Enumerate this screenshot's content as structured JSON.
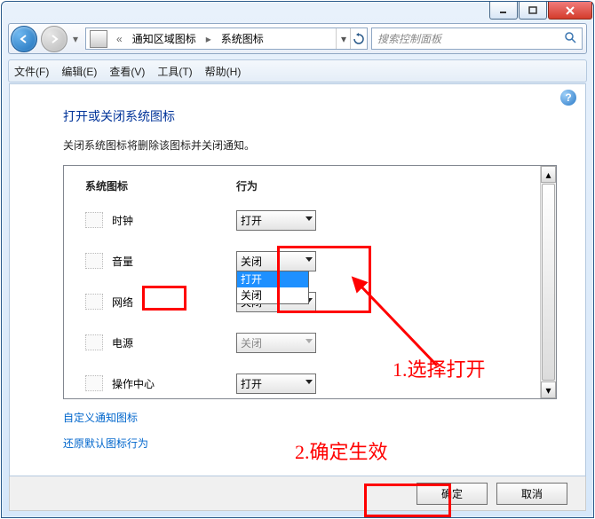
{
  "breadcrumb": {
    "item1": "通知区域图标",
    "item2": "系统图标"
  },
  "search": {
    "placeholder": "搜索控制面板"
  },
  "menu": {
    "file": "文件(F)",
    "edit": "编辑(E)",
    "view": "查看(V)",
    "tools": "工具(T)",
    "help": "帮助(H)"
  },
  "heading": "打开或关闭系统图标",
  "subtext": "关闭系统图标将删除该图标并关闭通知。",
  "columns": {
    "c1": "系统图标",
    "c2": "行为"
  },
  "options": {
    "open": "打开",
    "close": "关闭"
  },
  "rows": [
    {
      "label": "时钟",
      "value": "打开",
      "disabled": false
    },
    {
      "label": "音量",
      "value": "关闭",
      "disabled": false,
      "dropdownOpen": true
    },
    {
      "label": "网络",
      "value": "关闭",
      "disabled": false
    },
    {
      "label": "电源",
      "value": "关闭",
      "disabled": true
    },
    {
      "label": "操作中心",
      "value": "打开",
      "disabled": false
    }
  ],
  "links": {
    "custom": "自定义通知图标",
    "restore": "还原默认图标行为"
  },
  "buttons": {
    "ok": "确定",
    "cancel": "取消"
  },
  "annotations": {
    "a1": "1.选择打开",
    "a2": "2.确定生效"
  }
}
